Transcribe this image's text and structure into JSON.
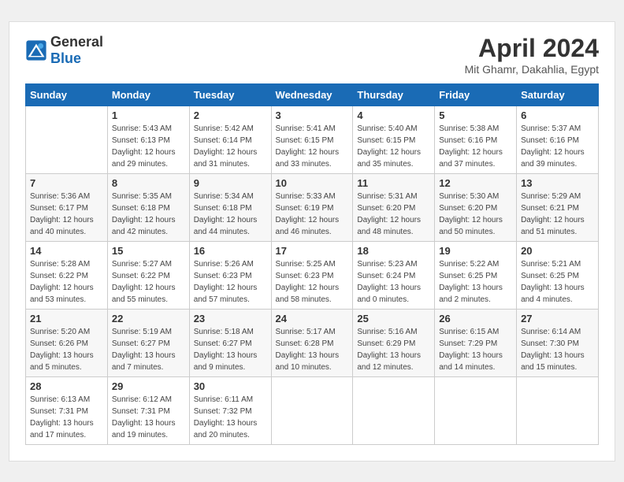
{
  "header": {
    "logo_line1": "General",
    "logo_line2": "Blue",
    "month_title": "April 2024",
    "location": "Mit Ghamr, Dakahlia, Egypt"
  },
  "weekdays": [
    "Sunday",
    "Monday",
    "Tuesday",
    "Wednesday",
    "Thursday",
    "Friday",
    "Saturday"
  ],
  "weeks": [
    [
      {
        "day": "",
        "sunrise": "",
        "sunset": "",
        "daylight": ""
      },
      {
        "day": "1",
        "sunrise": "Sunrise: 5:43 AM",
        "sunset": "Sunset: 6:13 PM",
        "daylight": "Daylight: 12 hours and 29 minutes."
      },
      {
        "day": "2",
        "sunrise": "Sunrise: 5:42 AM",
        "sunset": "Sunset: 6:14 PM",
        "daylight": "Daylight: 12 hours and 31 minutes."
      },
      {
        "day": "3",
        "sunrise": "Sunrise: 5:41 AM",
        "sunset": "Sunset: 6:15 PM",
        "daylight": "Daylight: 12 hours and 33 minutes."
      },
      {
        "day": "4",
        "sunrise": "Sunrise: 5:40 AM",
        "sunset": "Sunset: 6:15 PM",
        "daylight": "Daylight: 12 hours and 35 minutes."
      },
      {
        "day": "5",
        "sunrise": "Sunrise: 5:38 AM",
        "sunset": "Sunset: 6:16 PM",
        "daylight": "Daylight: 12 hours and 37 minutes."
      },
      {
        "day": "6",
        "sunrise": "Sunrise: 5:37 AM",
        "sunset": "Sunset: 6:16 PM",
        "daylight": "Daylight: 12 hours and 39 minutes."
      }
    ],
    [
      {
        "day": "7",
        "sunrise": "Sunrise: 5:36 AM",
        "sunset": "Sunset: 6:17 PM",
        "daylight": "Daylight: 12 hours and 40 minutes."
      },
      {
        "day": "8",
        "sunrise": "Sunrise: 5:35 AM",
        "sunset": "Sunset: 6:18 PM",
        "daylight": "Daylight: 12 hours and 42 minutes."
      },
      {
        "day": "9",
        "sunrise": "Sunrise: 5:34 AM",
        "sunset": "Sunset: 6:18 PM",
        "daylight": "Daylight: 12 hours and 44 minutes."
      },
      {
        "day": "10",
        "sunrise": "Sunrise: 5:33 AM",
        "sunset": "Sunset: 6:19 PM",
        "daylight": "Daylight: 12 hours and 46 minutes."
      },
      {
        "day": "11",
        "sunrise": "Sunrise: 5:31 AM",
        "sunset": "Sunset: 6:20 PM",
        "daylight": "Daylight: 12 hours and 48 minutes."
      },
      {
        "day": "12",
        "sunrise": "Sunrise: 5:30 AM",
        "sunset": "Sunset: 6:20 PM",
        "daylight": "Daylight: 12 hours and 50 minutes."
      },
      {
        "day": "13",
        "sunrise": "Sunrise: 5:29 AM",
        "sunset": "Sunset: 6:21 PM",
        "daylight": "Daylight: 12 hours and 51 minutes."
      }
    ],
    [
      {
        "day": "14",
        "sunrise": "Sunrise: 5:28 AM",
        "sunset": "Sunset: 6:22 PM",
        "daylight": "Daylight: 12 hours and 53 minutes."
      },
      {
        "day": "15",
        "sunrise": "Sunrise: 5:27 AM",
        "sunset": "Sunset: 6:22 PM",
        "daylight": "Daylight: 12 hours and 55 minutes."
      },
      {
        "day": "16",
        "sunrise": "Sunrise: 5:26 AM",
        "sunset": "Sunset: 6:23 PM",
        "daylight": "Daylight: 12 hours and 57 minutes."
      },
      {
        "day": "17",
        "sunrise": "Sunrise: 5:25 AM",
        "sunset": "Sunset: 6:23 PM",
        "daylight": "Daylight: 12 hours and 58 minutes."
      },
      {
        "day": "18",
        "sunrise": "Sunrise: 5:23 AM",
        "sunset": "Sunset: 6:24 PM",
        "daylight": "Daylight: 13 hours and 0 minutes."
      },
      {
        "day": "19",
        "sunrise": "Sunrise: 5:22 AM",
        "sunset": "Sunset: 6:25 PM",
        "daylight": "Daylight: 13 hours and 2 minutes."
      },
      {
        "day": "20",
        "sunrise": "Sunrise: 5:21 AM",
        "sunset": "Sunset: 6:25 PM",
        "daylight": "Daylight: 13 hours and 4 minutes."
      }
    ],
    [
      {
        "day": "21",
        "sunrise": "Sunrise: 5:20 AM",
        "sunset": "Sunset: 6:26 PM",
        "daylight": "Daylight: 13 hours and 5 minutes."
      },
      {
        "day": "22",
        "sunrise": "Sunrise: 5:19 AM",
        "sunset": "Sunset: 6:27 PM",
        "daylight": "Daylight: 13 hours and 7 minutes."
      },
      {
        "day": "23",
        "sunrise": "Sunrise: 5:18 AM",
        "sunset": "Sunset: 6:27 PM",
        "daylight": "Daylight: 13 hours and 9 minutes."
      },
      {
        "day": "24",
        "sunrise": "Sunrise: 5:17 AM",
        "sunset": "Sunset: 6:28 PM",
        "daylight": "Daylight: 13 hours and 10 minutes."
      },
      {
        "day": "25",
        "sunrise": "Sunrise: 5:16 AM",
        "sunset": "Sunset: 6:29 PM",
        "daylight": "Daylight: 13 hours and 12 minutes."
      },
      {
        "day": "26",
        "sunrise": "Sunrise: 6:15 AM",
        "sunset": "Sunset: 7:29 PM",
        "daylight": "Daylight: 13 hours and 14 minutes."
      },
      {
        "day": "27",
        "sunrise": "Sunrise: 6:14 AM",
        "sunset": "Sunset: 7:30 PM",
        "daylight": "Daylight: 13 hours and 15 minutes."
      }
    ],
    [
      {
        "day": "28",
        "sunrise": "Sunrise: 6:13 AM",
        "sunset": "Sunset: 7:31 PM",
        "daylight": "Daylight: 13 hours and 17 minutes."
      },
      {
        "day": "29",
        "sunrise": "Sunrise: 6:12 AM",
        "sunset": "Sunset: 7:31 PM",
        "daylight": "Daylight: 13 hours and 19 minutes."
      },
      {
        "day": "30",
        "sunrise": "Sunrise: 6:11 AM",
        "sunset": "Sunset: 7:32 PM",
        "daylight": "Daylight: 13 hours and 20 minutes."
      },
      {
        "day": "",
        "sunrise": "",
        "sunset": "",
        "daylight": ""
      },
      {
        "day": "",
        "sunrise": "",
        "sunset": "",
        "daylight": ""
      },
      {
        "day": "",
        "sunrise": "",
        "sunset": "",
        "daylight": ""
      },
      {
        "day": "",
        "sunrise": "",
        "sunset": "",
        "daylight": ""
      }
    ]
  ]
}
